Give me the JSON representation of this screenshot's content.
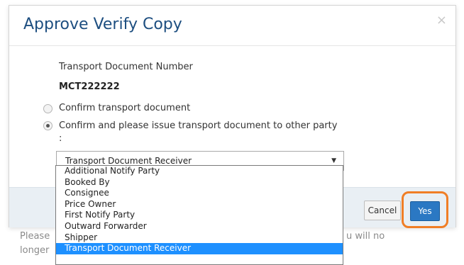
{
  "modal": {
    "title": "Approve Verify Copy",
    "close_glyph": "×",
    "field_label": "Transport Document Number",
    "field_value": "MCT222222",
    "radio_options": [
      {
        "label": "Confirm transport document",
        "checked": false
      },
      {
        "label": "Confirm and please issue transport document to other party :",
        "checked": true
      }
    ],
    "select": {
      "value": "Transport Document Receiver",
      "arrow_icon": "chevron-down-icon",
      "options": [
        "Additional Notify Party",
        "Booked By",
        "Consignee",
        "Price Owner",
        "First Notify Party",
        "Outward Forwarder",
        "Shipper",
        "Transport Document Receiver"
      ],
      "selected_index": 7
    },
    "buttons": {
      "cancel": "Cancel",
      "yes": "Yes"
    }
  },
  "background_text": {
    "line1_left": "Please",
    "line1_right": "u will no",
    "line2_left": "longer"
  },
  "colors": {
    "title": "#1d4e80",
    "primary_button": "#2b78c3",
    "highlight_ring": "#f07e26",
    "selected_option": "#1e90ff"
  }
}
